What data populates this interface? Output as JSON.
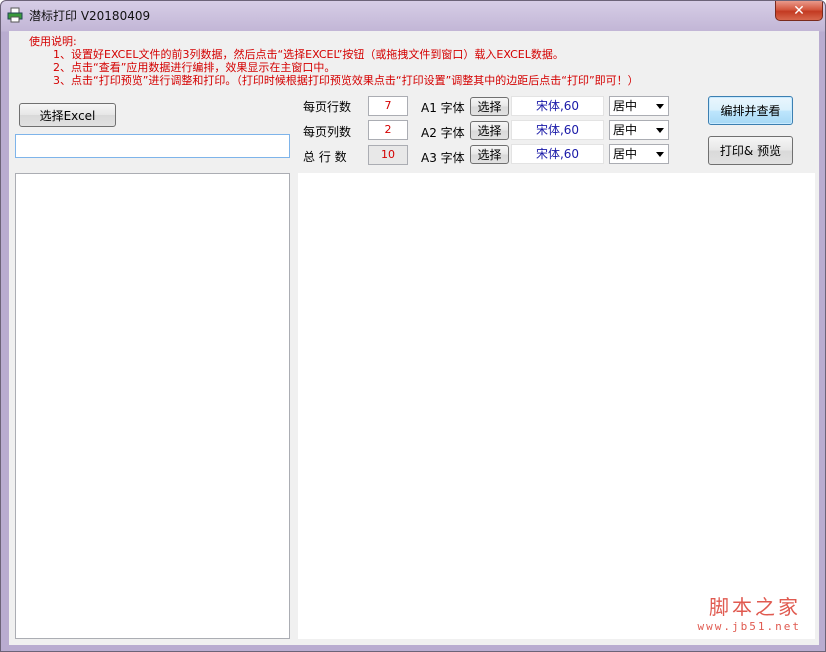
{
  "window": {
    "title": "潜标打印 V20180409",
    "close_glyph": "✕",
    "close_icon": "close-icon",
    "app_icon": "printer-icon"
  },
  "instructions": {
    "heading": "使用说明:",
    "lines": [
      "1、设置好EXCEL文件的前3列数据，然后点击“选择EXCEL”按钮（或拖拽文件到窗口）载入EXCEL数据。",
      "2、点击“查看”应用数据进行编排，效果显示在主窗口中。",
      "3、点击“打印预览”进行调整和打印。（打印时候根据打印预览效果点击“打印设置”调整其中的边距后点击“打印”即可！）"
    ]
  },
  "left": {
    "select_excel_label": "选择Excel",
    "file_path_value": ""
  },
  "settings": {
    "rows_per_page_label": "每页行数",
    "rows_per_page_value": "7",
    "cols_per_page_label": "每页列数",
    "cols_per_page_value": "2",
    "total_rows_label": "总 行 数",
    "total_rows_value": "10"
  },
  "fonts": [
    {
      "label": "A1 字体",
      "button": "选择",
      "font": "宋体,60",
      "align": "居中"
    },
    {
      "label": "A2 字体",
      "button": "选择",
      "font": "宋体,60",
      "align": "居中"
    },
    {
      "label": "A3 字体",
      "button": "选择",
      "font": "宋体,60",
      "align": "居中"
    }
  ],
  "actions": {
    "arrange_view_label": "编排并查看",
    "print_preview_label": "打印& 预览"
  },
  "watermark": {
    "main": "脚本之家",
    "url": "www.jb51.net"
  },
  "colors": {
    "instructions": "#d40000",
    "font_value": "#1a1aa8",
    "title_bar": "#c2b6d6"
  }
}
